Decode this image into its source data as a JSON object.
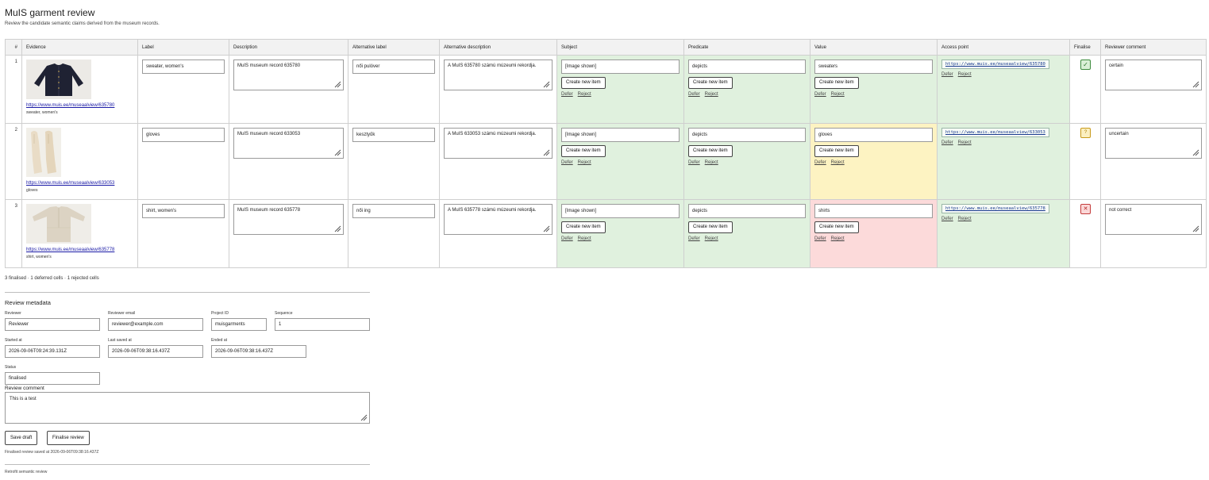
{
  "header": {
    "title": "MuIS garment review",
    "subtitle": "Review the candidate semantic claims derived from the museum records."
  },
  "table": {
    "columns": [
      "#",
      "Evidence",
      "Label",
      "Description",
      "Alternative label",
      "Alternative description",
      "Subject",
      "Predicate",
      "Value",
      "Access point",
      "Finalise",
      "Reviewer comment"
    ],
    "rows": [
      {
        "num": "1",
        "evidence_link": "https://www.muis.ee/museaalview/635780",
        "evidence_caption": "sweater, women's",
        "image_icon": "sweater-image",
        "label": "sweater, women's",
        "description": "MuIS museum record 635780",
        "alt_label": "női pulóver",
        "alt_description": "A MuIS 635780 számú múzeumi rekordja.",
        "subject": "[Image shown]",
        "predicate": "depicts",
        "value": "sweaters",
        "access_point": "https://www.muis.ee/museaalview/635780",
        "create_label": "Create new item",
        "defer_label": "Defer",
        "reject_label": "Reject",
        "finalise_icon": "check-icon",
        "finalise_glyph": "✓",
        "comment": "certain",
        "value_color": "#e0f1de"
      },
      {
        "num": "2",
        "evidence_link": "https://www.muis.ee/museaalview/633053",
        "evidence_caption": "gloves",
        "image_icon": "gloves-image",
        "label": "gloves",
        "description": "MuIS museum record 633053",
        "alt_label": "kesztyűk",
        "alt_description": "A MuIS 633053 számú múzeumi rekordja.",
        "subject": "[Image shown]",
        "predicate": "depicts",
        "value": "gloves",
        "access_point": "https://www.muis.ee/museaalview/633053",
        "create_label": "Create new item",
        "defer_label": "Defer",
        "reject_label": "Reject",
        "finalise_icon": "question-icon",
        "finalise_glyph": "?",
        "comment": "uncertain",
        "value_color": "#fdf3c2"
      },
      {
        "num": "3",
        "evidence_link": "https://www.muis.ee/museaalview/635778",
        "evidence_caption": "shirt, women's",
        "image_icon": "shirt-image",
        "label": "shirt, women's",
        "description": "MuIS museum record 635778",
        "alt_label": "női ing",
        "alt_description": "A MuIS 635778 számú múzeumi rekordja.",
        "subject": "[Image shown]",
        "predicate": "depicts",
        "value": "shirts",
        "access_point": "https://www.muis.ee/museaalview/635778",
        "create_label": "Create new item",
        "defer_label": "Defer",
        "reject_label": "Reject",
        "finalise_icon": "cross-icon",
        "finalise_glyph": "✕",
        "comment": "not correct",
        "value_color": "#fcdada"
      }
    ]
  },
  "summary": "3 finalised · 1 deferred cells · 1 rejected cells",
  "metadata": {
    "title": "Review metadata",
    "reviewer_label": "Reviewer",
    "reviewer_value": "Reviewer",
    "email_label": "Reviewer email",
    "email_value": "reviewer@example.com",
    "project_label": "Project ID",
    "project_value": "muisgarments",
    "sequence_label": "Sequence",
    "sequence_value": "1",
    "started_label": "Started at",
    "started_value": "2026-09-06T09:24:39.131Z",
    "lastsaved_label": "Last saved at",
    "lastsaved_value": "2026-09-06T09:38:16.437Z",
    "ended_label": "Ended at",
    "ended_value": "2026-09-06T09:38:16.437Z",
    "status_label": "Status",
    "status_value": "finalised",
    "comment_label": "Review comment",
    "comment_value": "This is a test"
  },
  "buttons": {
    "save_draft": "Save draft",
    "finalise": "Finalise review"
  },
  "saved_note": "Finalised review saved at 2026-09-06T09:38:16.437Z",
  "footer_hint": "Retrofit semantic review",
  "colors": {
    "accept": "#e0f1de",
    "uncertain": "#fdf3c2",
    "reject": "#fcdada"
  }
}
